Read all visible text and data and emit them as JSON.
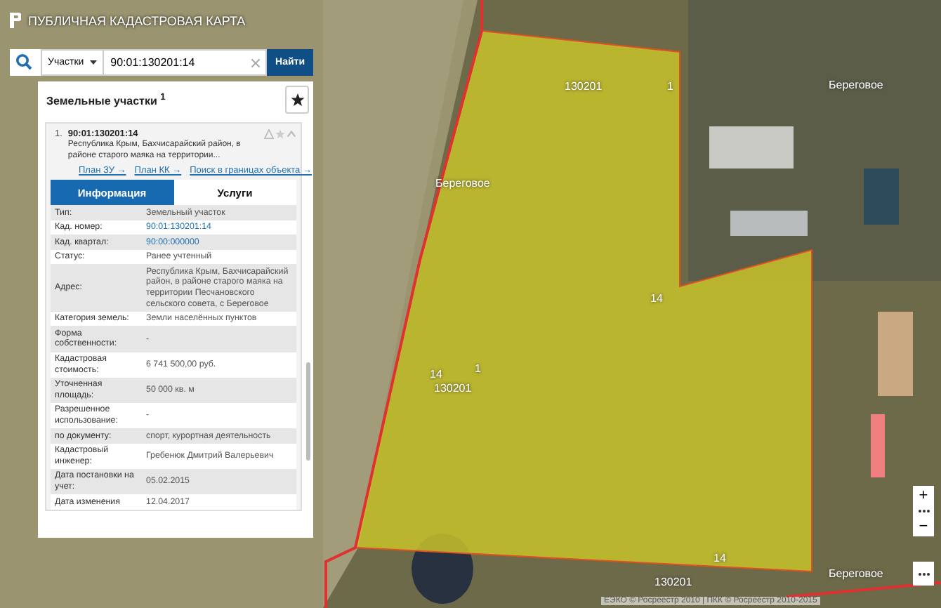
{
  "header": {
    "title": "ПУБЛИЧНАЯ КАДАСТРОВАЯ КАРТА"
  },
  "search": {
    "category": "Участки",
    "value": "90:01:130201:14",
    "button": "Найти"
  },
  "results": {
    "title": "Земельные участки $^{1}$",
    "item": {
      "index": "1.",
      "number": "90:01:130201:14",
      "address": "Республика Крым, Бахчисарайский район, в районе старого маяка на территории...",
      "links": [
        "План ЗУ →",
        "План КК →",
        "Поиск в границах объекта →"
      ]
    }
  },
  "tabs": [
    {
      "label": "Информация",
      "selected": true
    },
    {
      "label": "Услуги",
      "selected": false
    }
  ],
  "info": [
    {
      "label": "Тип:",
      "value": "Земельный участок",
      "kind": "text"
    },
    {
      "label": "Кад. номер:",
      "value": "90:01:130201:14",
      "kind": "link"
    },
    {
      "label": "Кад. квартал:",
      "value": "90:00:000000",
      "kind": "link"
    },
    {
      "label": "Статус:",
      "value": "Ранее учтенный",
      "kind": "text"
    },
    {
      "label": "Адрес:",
      "value": "Республика Крым, Бахчисарайский район, в районе старого маяка на территории Песчановского сельского совета, с Береговое",
      "kind": "text"
    },
    {
      "label": "Категория земель:",
      "value": "Земли населённых пунктов",
      "kind": "text"
    },
    {
      "label": "Форма собственности:",
      "value": "-",
      "kind": "text"
    },
    {
      "label": "Кадастровая стоимость:",
      "value": "6 741 500,00 руб.",
      "kind": "text"
    },
    {
      "label": "Уточненная площадь:",
      "value": "50 000 кв. м",
      "kind": "text"
    },
    {
      "label": "Разрешенное использование:",
      "value": "-",
      "kind": "text"
    },
    {
      "label": "по документу:",
      "value": "спорт, курортная деятельность",
      "kind": "text"
    },
    {
      "label": "Кадастровый инженер:",
      "value": "Гребенюк Дмитрий Валерьевич",
      "kind": "text"
    },
    {
      "label": "Дата постановки на учет:",
      "value": "05.02.2015",
      "kind": "text"
    },
    {
      "label": "Дата изменения",
      "value": "12.04.2017",
      "kind": "text"
    }
  ],
  "map": {
    "labels": [
      "130201",
      "1",
      "Береговое",
      "Береговое",
      "14",
      "14",
      "1",
      "130201",
      "14",
      "130201",
      "Береговое"
    ],
    "attribution": "ЕЭКО © Росреестр 2010 | ПКК © Росреестр 2010-2015"
  },
  "zoom": {
    "plus": "+",
    "minus": "−"
  }
}
